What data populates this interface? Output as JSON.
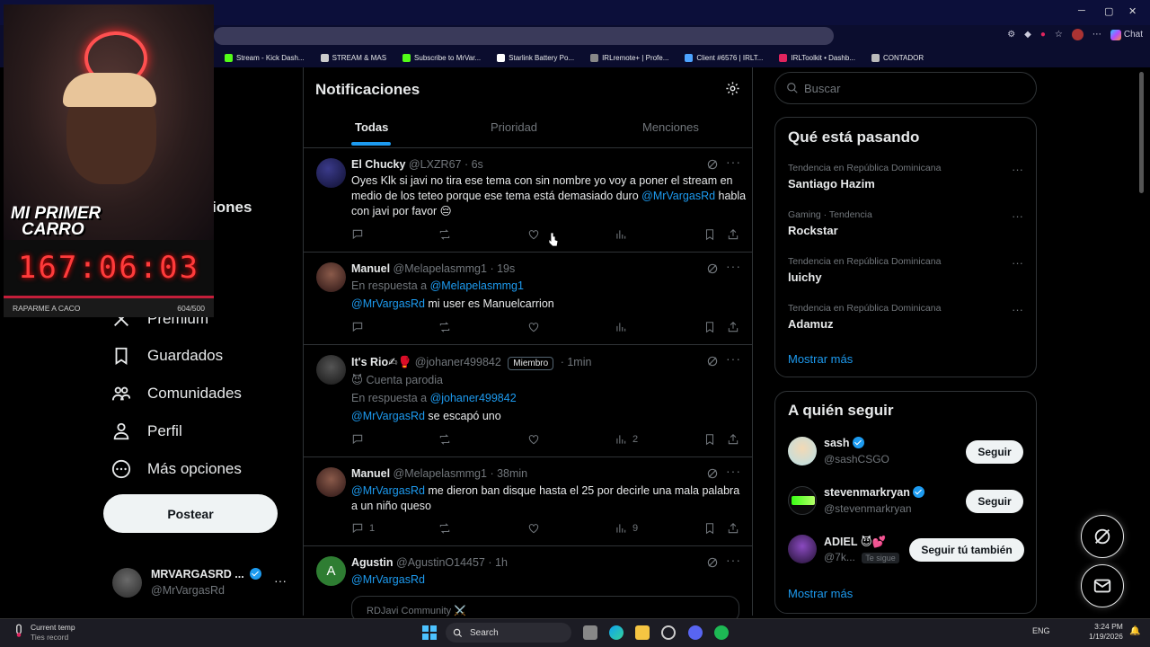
{
  "browser": {
    "chat_label": "Chat",
    "bookmarks": [
      {
        "label": "Stream - Kick Dash...",
        "color": "#53fc18"
      },
      {
        "label": "STREAM & MAS",
        "color": "#cccccc"
      },
      {
        "label": "Subscribe to MrVar...",
        "color": "#53fc18"
      },
      {
        "label": "Starlink Battery Po...",
        "color": "#ffffff"
      },
      {
        "label": "IRLremote+ | Profe...",
        "color": "#888888"
      },
      {
        "label": "Client #6576 | IRLT...",
        "color": "#4da3ff"
      },
      {
        "label": "IRLToolkit • Dashb...",
        "color": "#e0245e"
      },
      {
        "label": "CONTADOR",
        "color": "#bbbbbb"
      }
    ]
  },
  "overlay": {
    "cam_text_line1": "MI PRIMER",
    "cam_text_line2": "CARRO",
    "timer": "167:06:03",
    "goal_label": "RAPARME A CACO",
    "goal_count": "604/500"
  },
  "left_nav": {
    "partial_item": "iones",
    "premium": "Premium",
    "items": [
      {
        "label": "Guardados",
        "icon": "bookmark-icon"
      },
      {
        "label": "Comunidades",
        "icon": "communities-icon"
      },
      {
        "label": "Perfil",
        "icon": "profile-icon"
      },
      {
        "label": "Más opciones",
        "icon": "more-options-icon"
      }
    ],
    "post_label": "Postear",
    "account": {
      "name": "MRVARGASRD ...",
      "handle": "@MrVargasRd"
    }
  },
  "main": {
    "title": "Notificaciones",
    "tabs": [
      "Todas",
      "Prioridad",
      "Menciones"
    ],
    "tweets": [
      {
        "name": "El Chucky",
        "handle": "@LXZR67",
        "time": "· 6s",
        "text_parts": [
          "Oyes Klk si javi no tira ese tema  con sin nombre yo voy a poner el stream en medio de los teteo porque ese tema está demasiado duro ",
          "@MrVargasRd",
          " habla con javi por favor 😔"
        ],
        "replies": "",
        "views": ""
      },
      {
        "name": "Manuel",
        "handle": "@Melapelasmmg1",
        "time": "· 19s",
        "reply_to_label": "En respuesta a ",
        "reply_to": "@Melapelasmmg1",
        "mention": "@MrVargasRd",
        "text": " mi user es Manuelcarrion",
        "replies": "",
        "views": ""
      },
      {
        "name": "It's Rio✍🥊",
        "handle": "@johaner499842",
        "badge": "Miembro",
        "time": "· 1min",
        "parody": "😈 Cuenta parodia",
        "reply_to_label": "En respuesta a ",
        "reply_to": "@johaner499842",
        "mention": "@MrVargasRd",
        "text": "  se escapó uno",
        "replies": "",
        "views": "2"
      },
      {
        "name": "Manuel",
        "handle": "@Melapelasmmg1",
        "time": "· 38min",
        "mention": "@MrVargasRd",
        "text": " me dieron ban disque hasta el 25 por decirle una mala palabra a un niño queso",
        "replies": "1",
        "views": "9"
      },
      {
        "name": "Agustin",
        "handle": "@AgustinO14457",
        "time": "· 1h",
        "avatar_letter": "A",
        "mention": "@MrVargasRd",
        "community": "RDJavi Community ⚔️"
      }
    ]
  },
  "right": {
    "search_placeholder": "Buscar",
    "trends_title": "Qué está pasando",
    "trends": [
      {
        "meta": "Tendencia en República Dominicana",
        "name": "Santiago Hazim"
      },
      {
        "meta": "Gaming · Tendencia",
        "name": "Rockstar"
      },
      {
        "meta": "Tendencia en República Dominicana",
        "name": "luichy"
      },
      {
        "meta": "Tendencia en República Dominicana",
        "name": "Adamuz"
      }
    ],
    "show_more": "Mostrar más",
    "follow_title": "A quién seguir",
    "follow": [
      {
        "name": "sash",
        "handle": "@sashCSGO",
        "button": "Seguir",
        "verified": true,
        "follows_you": ""
      },
      {
        "name": "stevenmarkryan",
        "handle": "@stevenmarkryan",
        "button": "Seguir",
        "verified": true,
        "follows_you": ""
      },
      {
        "name": "ADIEL 😈💕",
        "handle": "@7k...",
        "button": "Seguir tú también",
        "verified": false,
        "follows_you": "Te sigue"
      }
    ]
  },
  "taskbar": {
    "weather_title": "Current temp",
    "weather_sub": "Ties record",
    "search_label": "Search",
    "lang": "ENG",
    "time": "3:24 PM",
    "date": "1/19/2026"
  },
  "colors": {
    "accent": "#1d9bf0",
    "background": "#000000",
    "text": "#e7e9ea",
    "muted": "#71767b"
  }
}
